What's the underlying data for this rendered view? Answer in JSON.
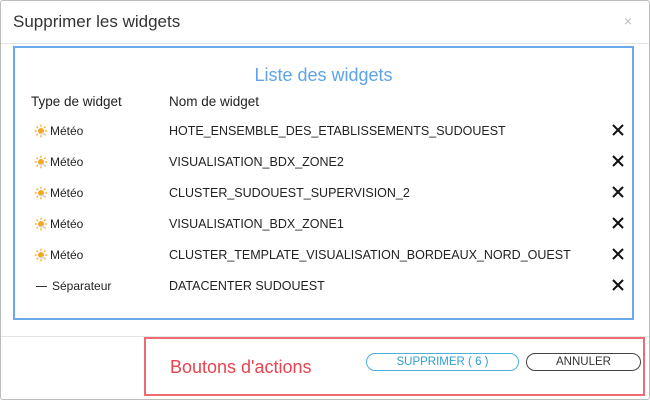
{
  "dialog": {
    "title": "Supprimer les widgets",
    "close_glyph": "×"
  },
  "list": {
    "title": "Liste des widgets",
    "headers": {
      "type": "Type de widget",
      "name": "Nom de widget"
    },
    "rows": [
      {
        "type": "Météo",
        "icon": "weather-sun-icon",
        "name": "HOTE_ENSEMBLE_DES_ETABLISSEMENTS_SUDOUEST"
      },
      {
        "type": "Météo",
        "icon": "weather-sun-icon",
        "name": "VISUALISATION_BDX_ZONE2"
      },
      {
        "type": "Météo",
        "icon": "weather-sun-icon",
        "name": "CLUSTER_SUDOUEST_SUPERVISION_2"
      },
      {
        "type": "Météo",
        "icon": "weather-sun-icon",
        "name": "VISUALISATION_BDX_ZONE1"
      },
      {
        "type": "Météo",
        "icon": "weather-sun-icon",
        "name": "CLUSTER_TEMPLATE_VISUALISATION_BORDEAUX_NORD_OUEST"
      },
      {
        "type": "Séparateur",
        "icon": "separator-dash-icon",
        "name": "DATACENTER SUDOUEST"
      }
    ]
  },
  "actions": {
    "label": "Boutons d'actions",
    "delete_label": "SUPPRIMER ( 6 )",
    "cancel_label": "ANNULER"
  },
  "colors": {
    "list_border": "#6aaaec",
    "list_title": "#5ea3ea",
    "actions_border": "#ee6b73",
    "actions_label": "#e8434f",
    "delete_button": "#2f9fd0",
    "sun_icon": "#f5a623"
  }
}
